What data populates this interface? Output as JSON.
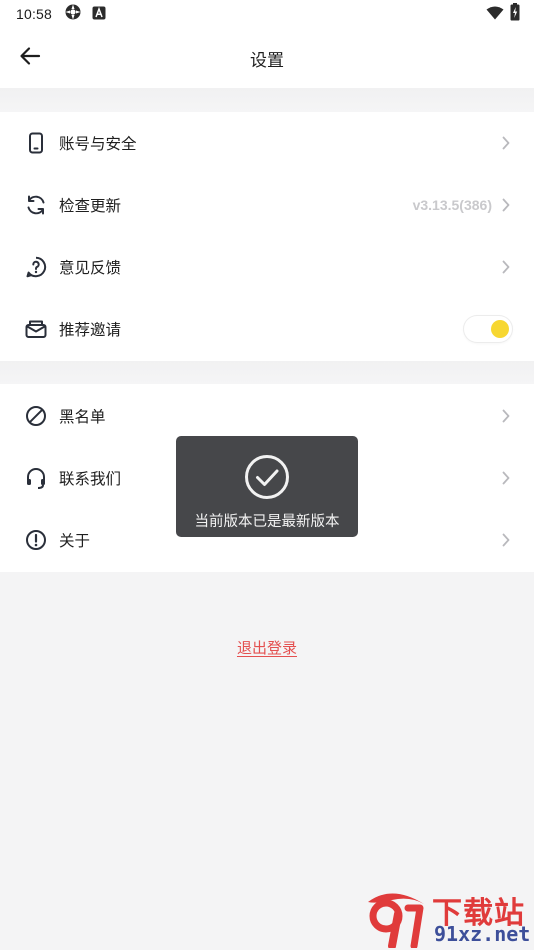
{
  "status_bar": {
    "time": "10:58"
  },
  "header": {
    "title": "设置",
    "back_icon": "arrow-left-icon"
  },
  "settings": {
    "group1": [
      {
        "label": "账号与安全",
        "icon": "phone-icon",
        "value": ""
      },
      {
        "label": "检查更新",
        "icon": "refresh-icon",
        "value": "v3.13.5(386)"
      },
      {
        "label": "意见反馈",
        "icon": "question-icon",
        "value": ""
      },
      {
        "label": "推荐邀请",
        "icon": "mail-icon",
        "toggle_on": true
      }
    ],
    "group2": [
      {
        "label": "黑名单",
        "icon": "block-icon"
      },
      {
        "label": "联系我们",
        "icon": "headset-icon"
      },
      {
        "label": "关于",
        "icon": "info-icon"
      }
    ]
  },
  "logout_label": "退出登录",
  "toast": {
    "message": "当前版本已是最新版本",
    "icon": "check-circle-icon"
  },
  "watermark": {
    "top_text": "下载站",
    "bottom_text": "91xz.net"
  },
  "colors": {
    "toggle_accent": "#f7d731",
    "logout": "#e45050",
    "toast_bg": "#46474a"
  }
}
